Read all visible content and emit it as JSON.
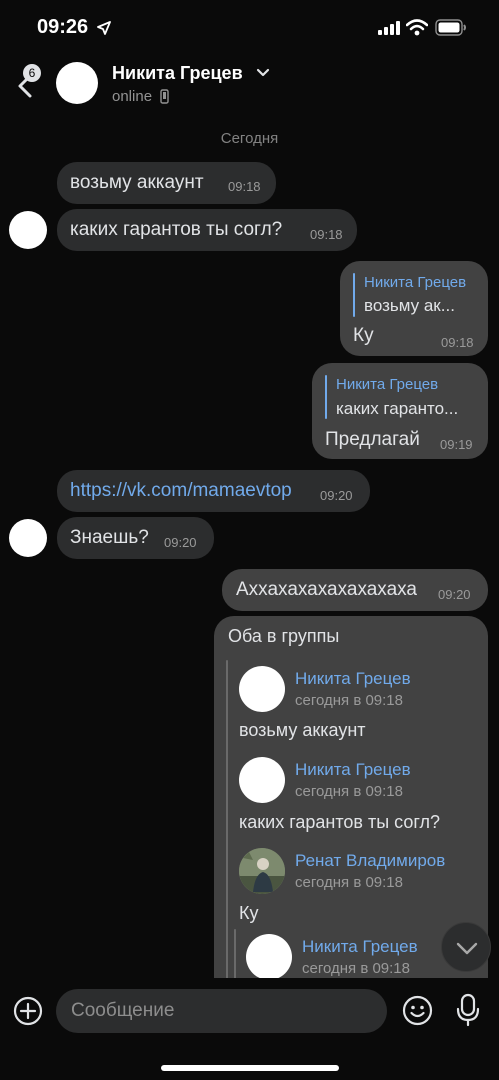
{
  "status_bar": {
    "time": "09:26"
  },
  "header": {
    "back_badge": "6",
    "contact_name": "Никита Грецев",
    "status": "online"
  },
  "date_separator": "Сегодня",
  "messages": [
    {
      "text": "возьму аккаунт",
      "time": "09:18"
    },
    {
      "text": "каких гарантов ты согл?",
      "time": "09:18"
    },
    {
      "reply_name": "Никита Грецев",
      "reply_text": "возьму ак...",
      "text": "Ку",
      "time": "09:18"
    },
    {
      "reply_name": "Никита Грецев",
      "reply_text": "каких гаранто...",
      "text": "Предлагай",
      "time": "09:19"
    },
    {
      "text": "https://vk.com/mamaevtop",
      "time": "09:20"
    },
    {
      "text": "Знаешь?",
      "time": "09:20"
    },
    {
      "text": "Аххахахахахахахаха",
      "time": "09:20"
    },
    {
      "text": "Оба в группы",
      "forwarded": [
        {
          "name": "Никита Грецев",
          "date": "сегодня в 09:18",
          "text": "возьму аккаунт"
        },
        {
          "name": "Никита Грецев",
          "date": "сегодня в 09:18",
          "text": "каких гарантов ты согл?"
        },
        {
          "name": "Ренат Владимиров",
          "date": "сегодня в 09:18",
          "text": "Ку"
        },
        {
          "name": "Никита Грецев",
          "date": "сегодня в 09:18"
        }
      ]
    }
  ],
  "composer": {
    "placeholder": "Сообщение"
  },
  "icons": {
    "back": "chevron-left-icon",
    "location": "location-arrow-icon",
    "signal": "signal-icon",
    "wifi": "wifi-icon",
    "battery": "battery-icon",
    "chevron": "chevron-down-icon",
    "phone": "phone-icon",
    "scroll": "arrow-down-icon",
    "add": "plus-circle-icon",
    "emoji": "emoji-icon",
    "mic": "microphone-icon"
  },
  "colors": {
    "background": "#0a0a0a",
    "incoming_bubble": "#2c2d2e",
    "outgoing_bubble": "#424242",
    "accent": "#71aaeb",
    "text": "#e1e3e6",
    "secondary_text": "#939393"
  }
}
